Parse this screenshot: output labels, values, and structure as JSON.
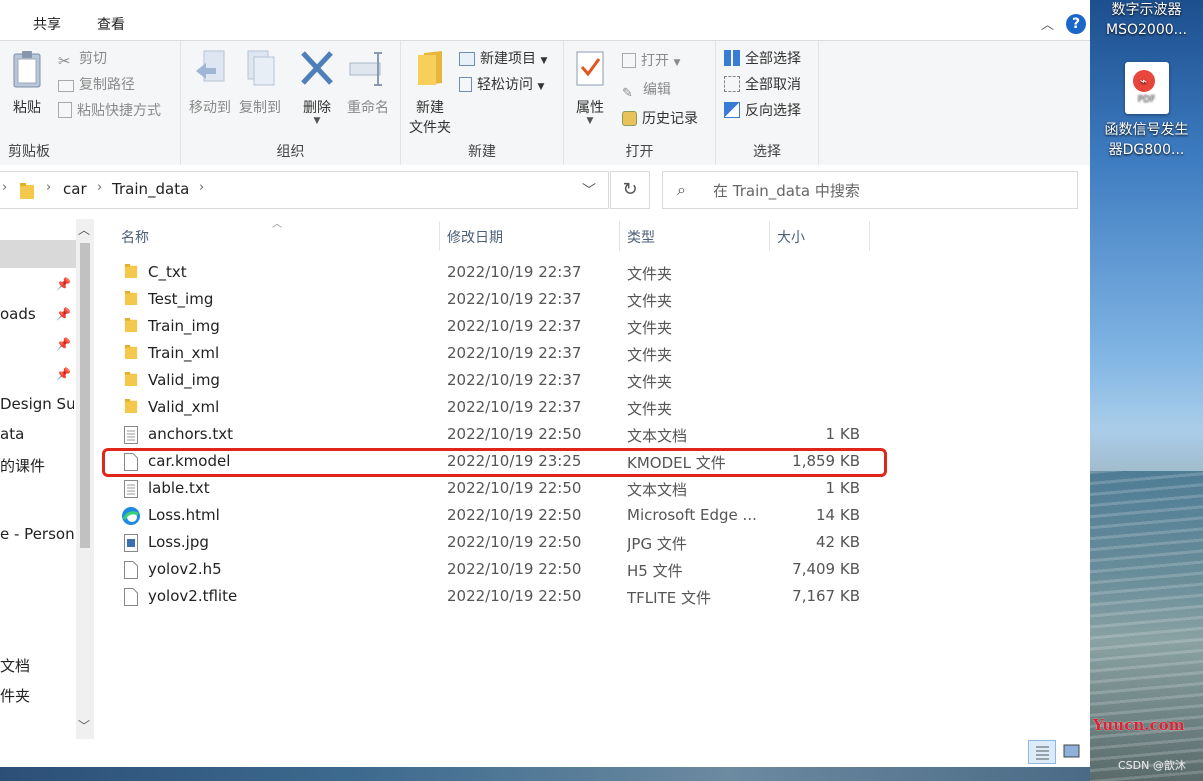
{
  "ribbon_tabs": [
    "共享",
    "查看"
  ],
  "ribbon": {
    "clipboard": {
      "label": "剪贴板",
      "paste": "粘贴",
      "cut": "剪切",
      "copy_path": "复制路径",
      "paste_shortcut": "粘贴快捷方式"
    },
    "organize": {
      "label": "组织",
      "move_to": "移动到",
      "copy_to": "复制到",
      "delete": "删除",
      "rename": "重命名"
    },
    "new": {
      "label": "新建",
      "new_folder_line1": "新建",
      "new_folder_line2": "文件夹",
      "new_item": "新建项目",
      "easy_access": "轻松访问"
    },
    "open": {
      "label": "打开",
      "properties": "属性",
      "open": "打开",
      "edit": "编辑",
      "history": "历史记录"
    },
    "select": {
      "label": "选择",
      "select_all": "全部选择",
      "select_none": "全部取消",
      "invert": "反向选择"
    }
  },
  "address": {
    "path": [
      "car",
      "Train_data"
    ],
    "search_placeholder": "在 Train_data 中搜索"
  },
  "nav": {
    "items": [
      {
        "label": "oads",
        "pinned": true
      },
      {
        "label": "Design Sui"
      },
      {
        "label": "ata"
      },
      {
        "label": "的课件"
      },
      {
        "label": "e - Persona"
      },
      {
        "label": "文档"
      },
      {
        "label": "件夹"
      }
    ]
  },
  "columns": {
    "name": "名称",
    "date": "修改日期",
    "type": "类型",
    "size": "大小"
  },
  "files": [
    {
      "name": "C_txt",
      "date": "2022/10/19 22:37",
      "type": "文件夹",
      "size": "",
      "icon": "folder"
    },
    {
      "name": "Test_img",
      "date": "2022/10/19 22:37",
      "type": "文件夹",
      "size": "",
      "icon": "folder"
    },
    {
      "name": "Train_img",
      "date": "2022/10/19 22:37",
      "type": "文件夹",
      "size": "",
      "icon": "folder"
    },
    {
      "name": "Train_xml",
      "date": "2022/10/19 22:37",
      "type": "文件夹",
      "size": "",
      "icon": "folder"
    },
    {
      "name": "Valid_img",
      "date": "2022/10/19 22:37",
      "type": "文件夹",
      "size": "",
      "icon": "folder"
    },
    {
      "name": "Valid_xml",
      "date": "2022/10/19 22:37",
      "type": "文件夹",
      "size": "",
      "icon": "folder"
    },
    {
      "name": "anchors.txt",
      "date": "2022/10/19 22:50",
      "type": "文本文档",
      "size": "1 KB",
      "icon": "text"
    },
    {
      "name": "car.kmodel",
      "date": "2022/10/19 23:25",
      "type": "KMODEL 文件",
      "size": "1,859 KB",
      "icon": "blank"
    },
    {
      "name": "lable.txt",
      "date": "2022/10/19 22:50",
      "type": "文本文档",
      "size": "1 KB",
      "icon": "text"
    },
    {
      "name": "Loss.html",
      "date": "2022/10/19 22:50",
      "type": "Microsoft Edge ...",
      "size": "14 KB",
      "icon": "edge"
    },
    {
      "name": "Loss.jpg",
      "date": "2022/10/19 22:50",
      "type": "JPG 文件",
      "size": "42 KB",
      "icon": "image"
    },
    {
      "name": "yolov2.h5",
      "date": "2022/10/19 22:50",
      "type": "H5 文件",
      "size": "7,409 KB",
      "icon": "blank"
    },
    {
      "name": "yolov2.tflite",
      "date": "2022/10/19 22:50",
      "type": "TFLITE 文件",
      "size": "7,167 KB",
      "icon": "blank"
    }
  ],
  "desktop": {
    "item1": "数字示波器\nMSO2000...",
    "item1_line1": "数字示波器",
    "item1_line2": "MSO2000...",
    "item2_line1": "函数信号发生",
    "item2_line2": "器DG800...",
    "pdf_label": "PDF",
    "watermark": "Yuucn.com",
    "credit": "CSDN @歆沐"
  }
}
